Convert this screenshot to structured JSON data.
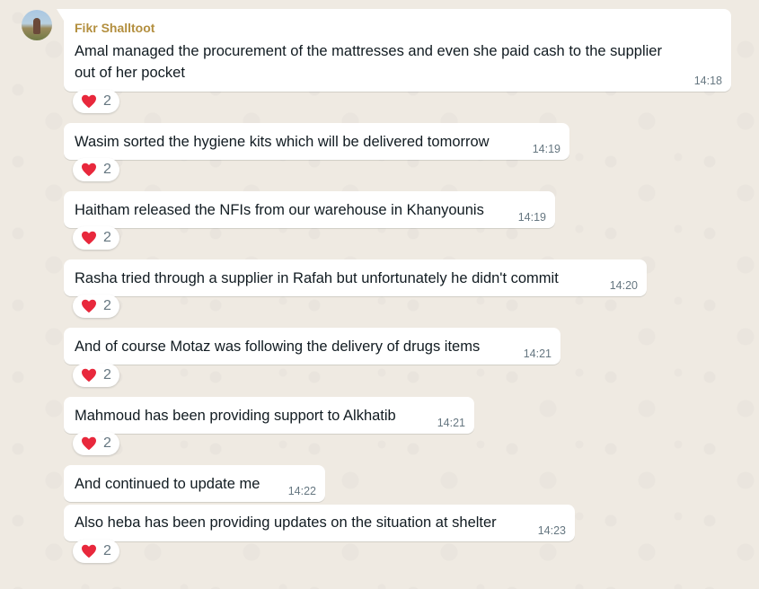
{
  "sender": {
    "name": "Fikr Shalltoot"
  },
  "messages": [
    {
      "lines": [
        "Amal managed the procurement of the mattresses and even she paid cash to the supplier",
        "out of her pocket"
      ],
      "time": "14:18",
      "reaction": {
        "emoji": "heart-icon",
        "count": "2"
      }
    },
    {
      "lines": [
        "Wasim sorted the hygiene kits which will be delivered tomorrow"
      ],
      "time": "14:19",
      "reaction": {
        "emoji": "heart-icon",
        "count": "2"
      }
    },
    {
      "lines": [
        "Haitham released the NFIs from our warehouse in Khanyounis"
      ],
      "time": "14:19",
      "reaction": {
        "emoji": "heart-icon",
        "count": "2"
      }
    },
    {
      "lines": [
        "Rasha tried through a supplier in Rafah but unfortunately he didn't commit"
      ],
      "time": "14:20",
      "reaction": {
        "emoji": "heart-icon",
        "count": "2"
      }
    },
    {
      "lines": [
        "And of course Motaz was following the delivery of drugs items"
      ],
      "time": "14:21",
      "reaction": {
        "emoji": "heart-icon",
        "count": "2"
      }
    },
    {
      "lines": [
        "Mahmoud has been providing support to Alkhatib"
      ],
      "time": "14:21",
      "reaction": {
        "emoji": "heart-icon",
        "count": "2"
      }
    },
    {
      "lines": [
        "And continued to update me"
      ],
      "time": "14:22"
    },
    {
      "lines": [
        "Also heba has been providing updates on the situation at shelter"
      ],
      "time": "14:23",
      "reaction": {
        "emoji": "heart-icon",
        "count": "2"
      }
    }
  ],
  "colors": {
    "background": "#efeae2",
    "bubble": "#ffffff",
    "sender_name": "#b38f3f",
    "timestamp": "#667781",
    "heart": "#e8283c"
  }
}
